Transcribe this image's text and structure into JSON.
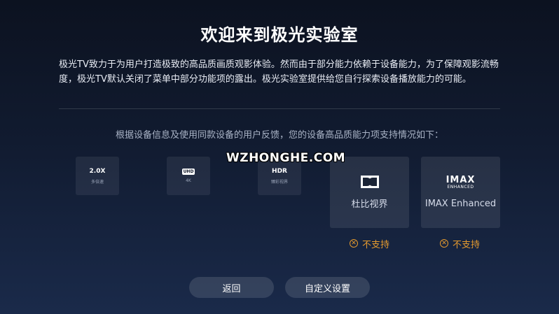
{
  "title": "欢迎来到极光实验室",
  "intro": "极光TV致力于为用户打造极致的高品质画质观影体验。然而由于部分能力依赖于设备能力，为了保障观影流畅度，极光TV默认关闭了菜单中部分功能项的露出。极光实验室提供给您自行探索设备播放能力的可能。",
  "subtitle": "根据设备信息及使用同款设备的用户反馈，您的设备高品质能力项支持情况如下：",
  "watermark": "WZHONGHE.COM",
  "features": [
    {
      "name": "2.0X",
      "sub": "多倍速"
    },
    {
      "name": "UHD",
      "sub": "4K"
    },
    {
      "name": "HDR",
      "sub": "臻彩视界"
    },
    {
      "icon": "dolby-icon",
      "label": "杜比视界",
      "status": "不支持"
    },
    {
      "logo": "IMAX",
      "logo_sub": "ENHANCED",
      "label": "IMAX Enhanced",
      "status": "不支持"
    }
  ],
  "buttons": {
    "back": "返回",
    "custom": "自定义设置"
  },
  "colors": {
    "unsupported": "#e59a2e"
  }
}
